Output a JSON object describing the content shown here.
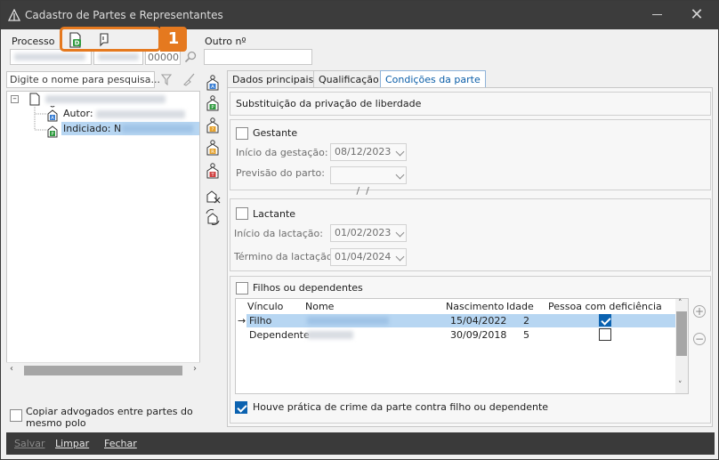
{
  "window": {
    "title": "Cadastro de Partes e Representantes"
  },
  "header": {
    "processo_label": "Processo",
    "processo_suffix": "00000",
    "outro_label": "Outro nº",
    "callout_number": "1"
  },
  "left": {
    "search_placeholder": "Digite o nome para pesquisa...",
    "tree": {
      "autor_label": "Autor:",
      "indiciado_label": "Indiciado: N"
    },
    "copy_lawyers_label": "Copiar advogados entre partes do mesmo polo"
  },
  "tabs": [
    {
      "label": "Dados principais"
    },
    {
      "label": "Qualificação"
    },
    {
      "label": "Condições da parte"
    }
  ],
  "conditions": {
    "privacao_label": "Substituição da privação de liberdade",
    "gestante": {
      "label": "Gestante",
      "inicio_label": "Início da gestação:",
      "inicio_value": "08/12/2023",
      "previsao_label": "Previsão do parto:",
      "previsao_value": " /  /"
    },
    "lactante": {
      "label": "Lactante",
      "inicio_label": "Início da lactação:",
      "inicio_value": "01/02/2023",
      "termino_label": "Término da lactação:",
      "termino_value": "01/04/2024"
    },
    "filhos": {
      "label": "Filhos ou dependentes",
      "columns": [
        "Vínculo",
        "Nome",
        "Nascimento",
        "Idade",
        "Pessoa com deficiência"
      ],
      "rows": [
        {
          "vinculo": "Filho",
          "nascimento": "15/04/2022",
          "idade": "2",
          "deficiencia": true
        },
        {
          "vinculo": "Dependente",
          "nascimento": "30/09/2018",
          "idade": "5",
          "deficiencia": false
        }
      ]
    },
    "crime_label": "Houve prática de crime da parte contra filho ou dependente"
  },
  "footer": {
    "salvar": "Salvar",
    "limpar": "Limpar",
    "fechar": "Fechar"
  },
  "colors": {
    "accent": "#0b62b0",
    "callout": "#e5791f",
    "selection": "#b7d6f2"
  }
}
